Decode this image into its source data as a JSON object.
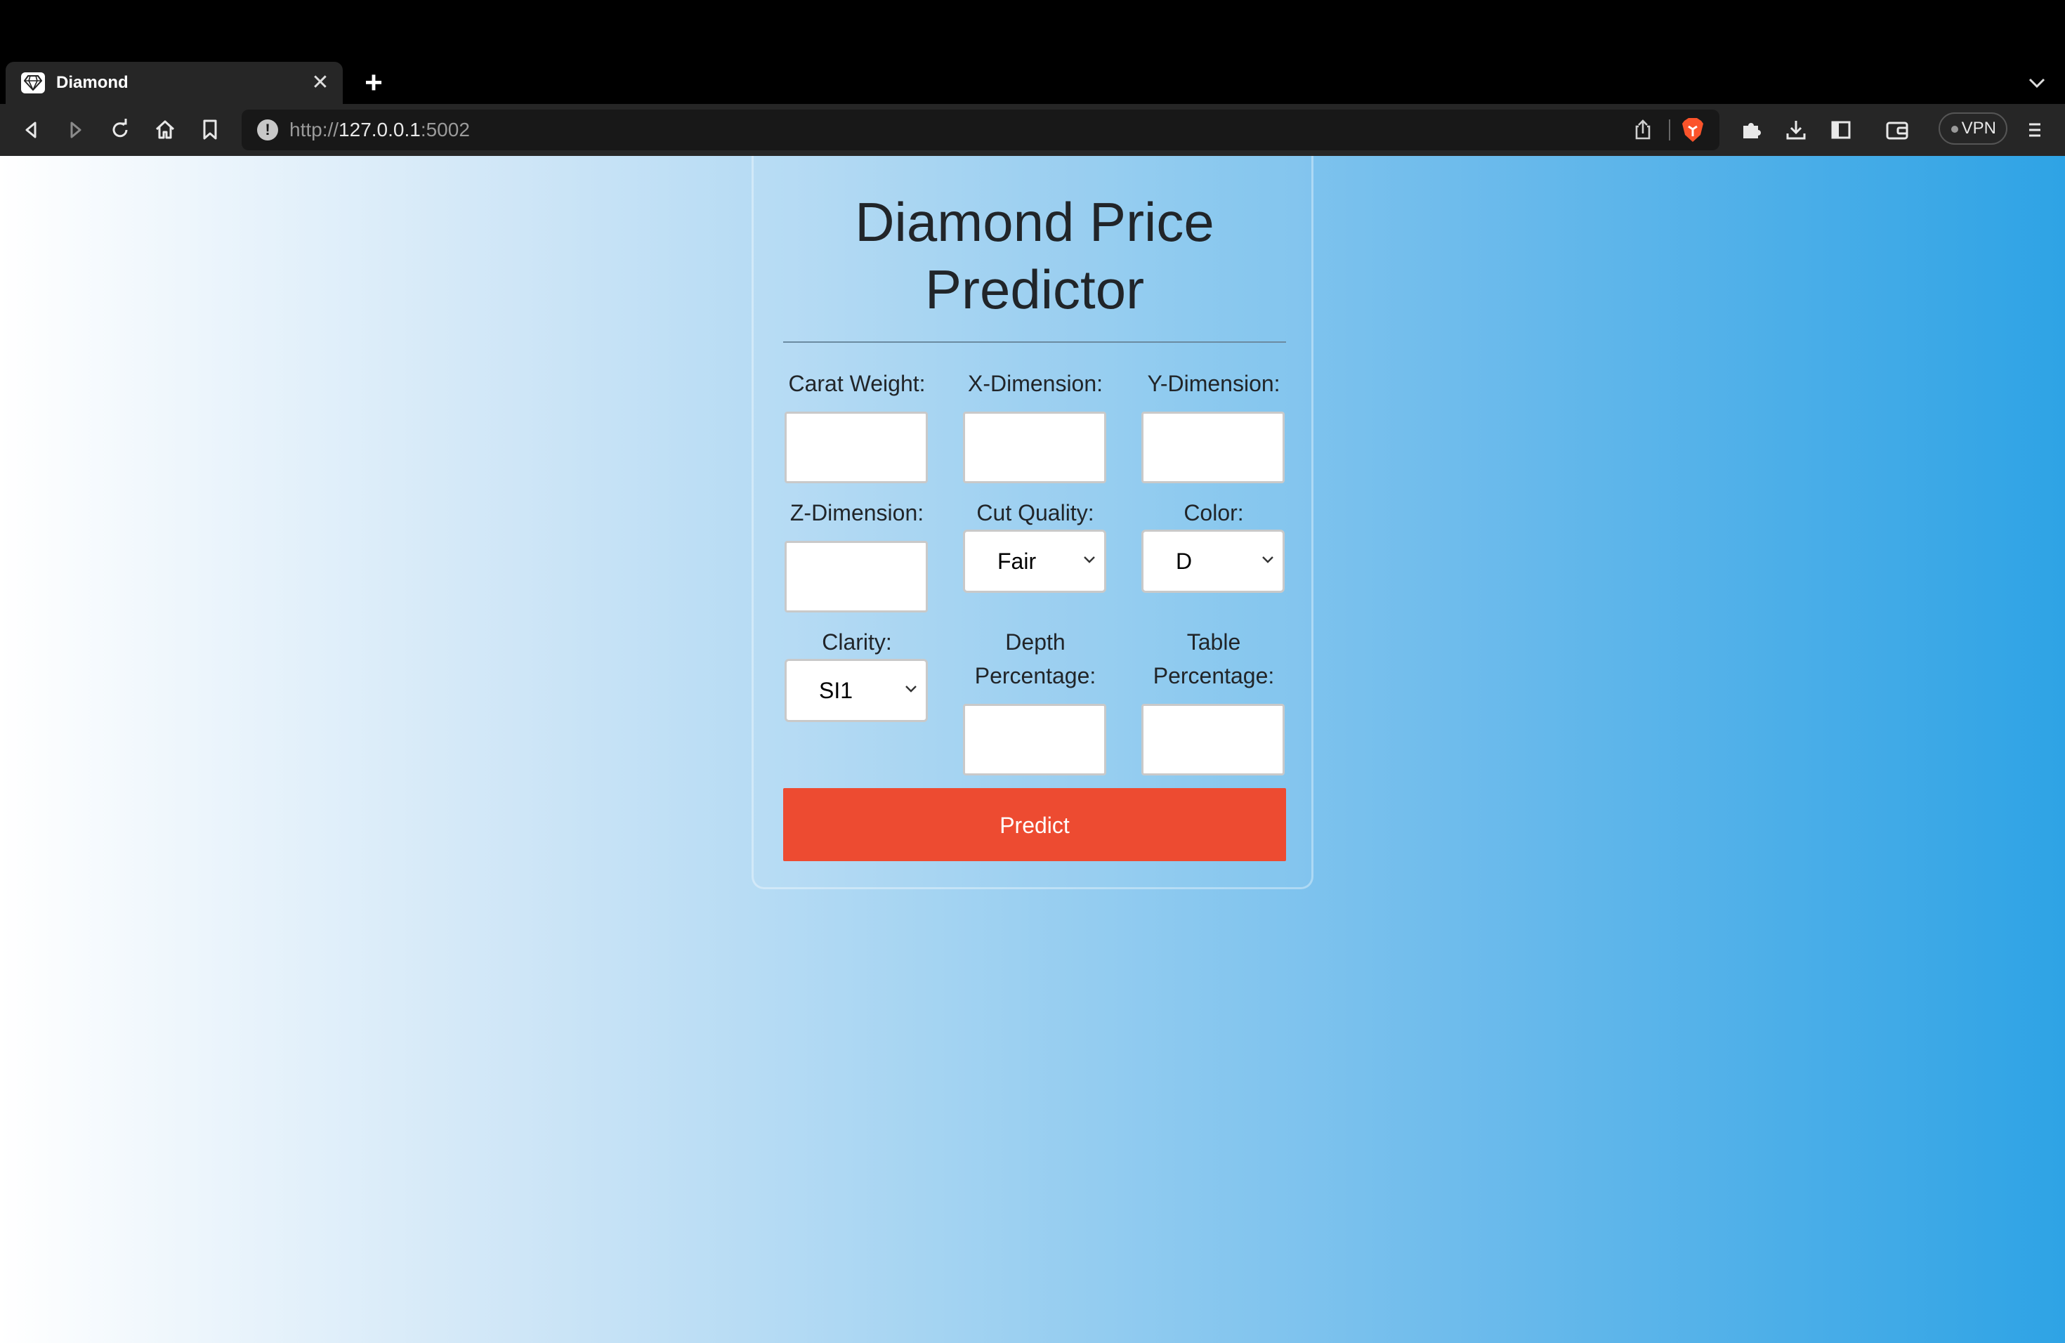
{
  "browser": {
    "tab_title": "Diamond",
    "url_scheme": "http://",
    "url_host": "127.0.0.1",
    "url_port": ":5002",
    "vpn_label": "VPN"
  },
  "form": {
    "title_line1": "Diamond Price",
    "title_line2": "Predictor",
    "fields": {
      "carat": {
        "label": "Carat Weight:",
        "value": ""
      },
      "x": {
        "label": "X-Dimension:",
        "value": ""
      },
      "y": {
        "label": "Y-Dimension:",
        "value": ""
      },
      "z": {
        "label": "Z-Dimension:",
        "value": ""
      },
      "cut": {
        "label": "Cut Quality:",
        "selected": "Fair"
      },
      "color": {
        "label": "Color:",
        "selected": "D"
      },
      "clarity": {
        "label": "Clarity:",
        "selected": "SI1"
      },
      "depth": {
        "label_line1": "Depth",
        "label_line2": "Percentage:",
        "value": ""
      },
      "table": {
        "label_line1": "Table",
        "label_line2": "Percentage:",
        "value": ""
      }
    },
    "submit_label": "Predict"
  },
  "colors": {
    "accent_button": "#ed4b31",
    "gradient_start": "#ffffff",
    "gradient_end": "#2ea3e5"
  }
}
